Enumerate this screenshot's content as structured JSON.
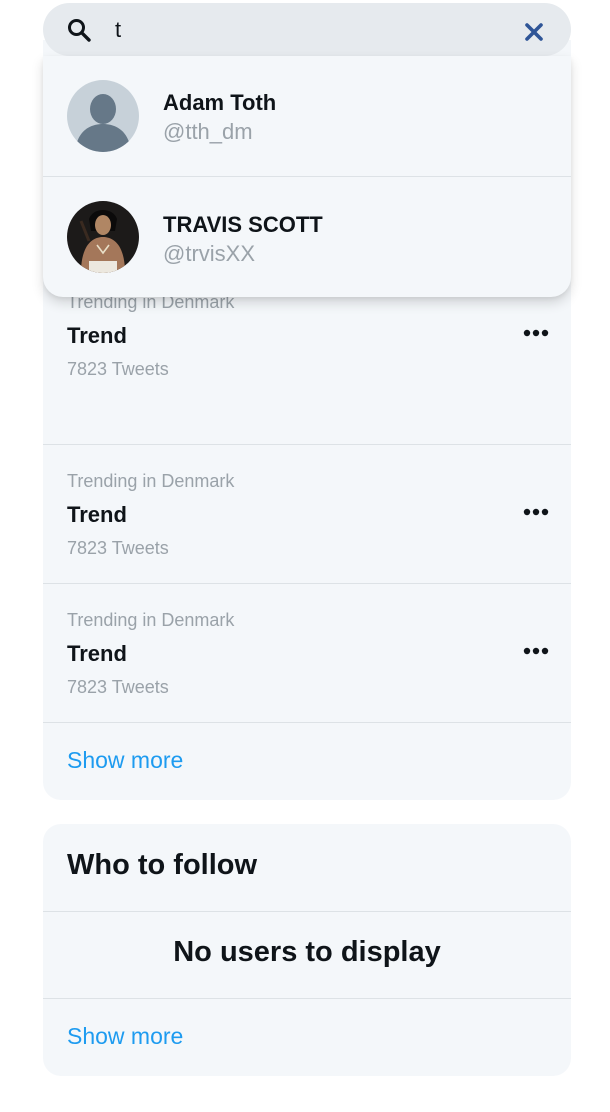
{
  "search": {
    "value": "t",
    "icon": "search-icon",
    "clear_icon": "close-icon",
    "accent_color": "#2f5597"
  },
  "results": [
    {
      "name": "Adam Toth",
      "handle": "@tth_dm",
      "avatar": "default-avatar"
    },
    {
      "name": "TRAVIS SCOTT",
      "handle": "@trvisXX",
      "avatar": "profile-photo"
    }
  ],
  "trends": {
    "items": [
      {
        "context": "Trending in Denmark",
        "name": "Trend",
        "count": "7823 Tweets"
      },
      {
        "context": "Trending in Denmark",
        "name": "Trend",
        "count": "7823 Tweets"
      },
      {
        "context": "Trending in Denmark",
        "name": "Trend",
        "count": "7823 Tweets"
      }
    ],
    "show_more": "Show more"
  },
  "who_to_follow": {
    "title": "Who to follow",
    "empty_message": "No users to display",
    "show_more": "Show more"
  },
  "colors": {
    "link": "#1d9bf0",
    "panel_bg": "#f4f7fa",
    "search_bg": "#e6eaee",
    "muted_text": "#9aa2a9"
  }
}
